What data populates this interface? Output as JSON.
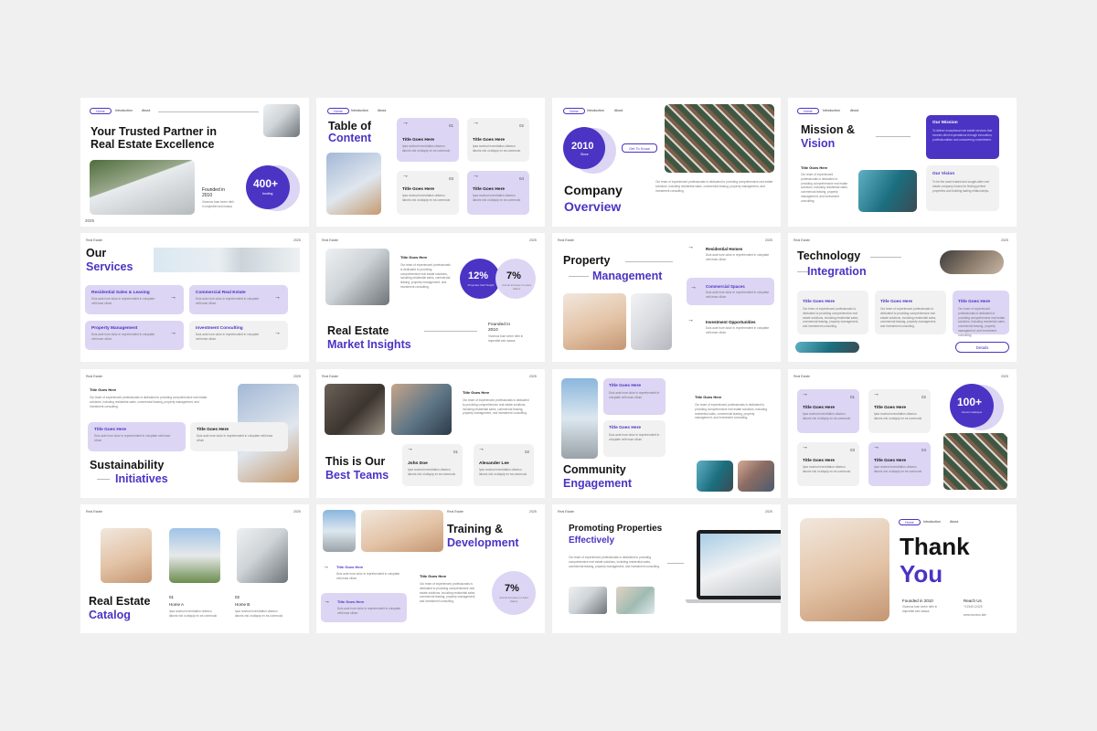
{
  "nav": {
    "home": "Home",
    "introduction": "Introduction",
    "about": "About"
  },
  "brand": "Real Estate",
  "year": "2025",
  "lorem": "Our team of experienced professionals is dedicated to providing comprehensive real estate solutions, including residential sales, commercial leasing, property management, and investment consulting.",
  "lorem_short": "Ipsa nostrud exercitation ullamco laboris nisi ut aliquip ex ea commodo",
  "lorem_tiny": "Duis aute irure dolor in reprehenderit in voluptate velit esse cillum",
  "s1": {
    "title1": "Your Trusted Partner in",
    "title2": "Real Estate Excellence",
    "founded": "Founded in",
    "founded_year": "2010",
    "founded_text": "Vivamus fuse lorem nibh in imperdiet sed massa",
    "stat": "400+",
    "stat_label": "funding",
    "corner": "2025"
  },
  "s2": {
    "title1": "Table of",
    "title2": "Content",
    "items": [
      {
        "num": "01",
        "title": "Title Goes Here"
      },
      {
        "num": "02",
        "title": "Title Goes Here"
      },
      {
        "num": "03",
        "title": "Title Goes Here"
      },
      {
        "num": "04",
        "title": "Title Goes Here"
      }
    ]
  },
  "s3": {
    "year": "2010",
    "year_label": "Since",
    "cta": "Get To Know",
    "title1": "Company",
    "title2": "Overview"
  },
  "s4": {
    "title1": "Mission &",
    "title2": "Vision",
    "mission": "Our Mission",
    "mission_text": "To deliver exceptional real estate services that exceed client expectations through innovation, professionalism and unwavering commitment.",
    "vision": "Our Vision",
    "vision_text": "To be the most trusted and sought-after real estate company known for finding perfect properties and building lasting relationships.",
    "item": "Title Goes Here"
  },
  "s5": {
    "title1": "Our",
    "title2": "Services",
    "items": [
      "Residential Sales & Leasing",
      "Commercial Real Estate",
      "Property Management",
      "Investment Consulting"
    ]
  },
  "s6": {
    "title1": "Real Estate",
    "title2": "Market Insights",
    "item": "Title Goes Here",
    "stat1": "12%",
    "stat1_label": "Properties Sold Tonight",
    "stat2": "7%",
    "stat2_label": "Annual Increase In Listed Values",
    "founded": "Founded in",
    "founded_year": "2010"
  },
  "s7": {
    "title1": "Property",
    "title2": "Management",
    "items": [
      "Residential Homes",
      "Commercial Spaces",
      "Investment Opportunities"
    ]
  },
  "s8": {
    "title1": "Technology",
    "title2": "Integration",
    "items": [
      "Title Goes Here",
      "Title Goes Here",
      "Title Goes Here"
    ],
    "cta": "Details"
  },
  "s9": {
    "title1": "Sustainability",
    "title2": "Initiatives",
    "item": "Title Goes Here"
  },
  "s10": {
    "title1": "This is Our",
    "title2": "Best Teams",
    "item": "Title Goes Here",
    "members": [
      {
        "num": "01",
        "name": "John Doe"
      },
      {
        "num": "02",
        "name": "Alexander Lee"
      }
    ]
  },
  "s11": {
    "title1": "Community",
    "title2": "Engagement",
    "item": "Title Goes Here"
  },
  "s12": {
    "stat": "100+",
    "stat_label": "Homes Catalogue",
    "items": [
      {
        "num": "01",
        "title": "Title Goes Here"
      },
      {
        "num": "02",
        "title": "Title Goes Here"
      },
      {
        "num": "03",
        "title": "Title Goes Here"
      },
      {
        "num": "04",
        "title": "Title Goes Here"
      }
    ]
  },
  "s13": {
    "title1": "Real Estate",
    "title2": "Catalog",
    "homes": [
      {
        "num": "01",
        "name": "Home A"
      },
      {
        "num": "02",
        "name": "Home B"
      }
    ]
  },
  "s14": {
    "title1": "Training &",
    "title2": "Development",
    "item": "Title Goes Here",
    "stat": "7%",
    "stat_label": "Annual Increase In Listed Values"
  },
  "s15": {
    "title1": "Promoting Properties",
    "title2": "Effectively"
  },
  "s16": {
    "title1": "Thank",
    "title2": "You",
    "founded": "Founded in 2010",
    "reach": "Reach Us",
    "phone": "+12345 12425",
    "web": "www.homeco.site"
  }
}
